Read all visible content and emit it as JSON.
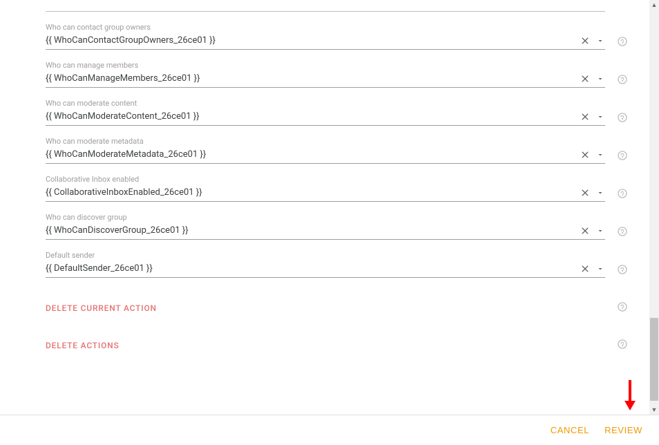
{
  "fields": [
    {
      "label": "Who can contact group owners",
      "value": "{{ WhoCanContactGroupOwners_26ce01 }}"
    },
    {
      "label": "Who can manage members",
      "value": "{{ WhoCanManageMembers_26ce01 }}"
    },
    {
      "label": "Who can moderate content",
      "value": "{{ WhoCanModerateContent_26ce01 }}"
    },
    {
      "label": "Who can moderate metadata",
      "value": "{{ WhoCanModerateMetadata_26ce01 }}"
    },
    {
      "label": "Collaborative Inbox enabled",
      "value": "{{ CollaborativeInboxEnabled_26ce01 }}"
    },
    {
      "label": "Who can discover group",
      "value": "{{ WhoCanDiscoverGroup_26ce01 }}"
    },
    {
      "label": "Default sender",
      "value": "{{ DefaultSender_26ce01 }}"
    }
  ],
  "actions": {
    "delete_current": "DELETE CURRENT ACTION",
    "delete_actions": "DELETE ACTIONS"
  },
  "footer": {
    "cancel": "CANCEL",
    "review": "REVIEW"
  }
}
